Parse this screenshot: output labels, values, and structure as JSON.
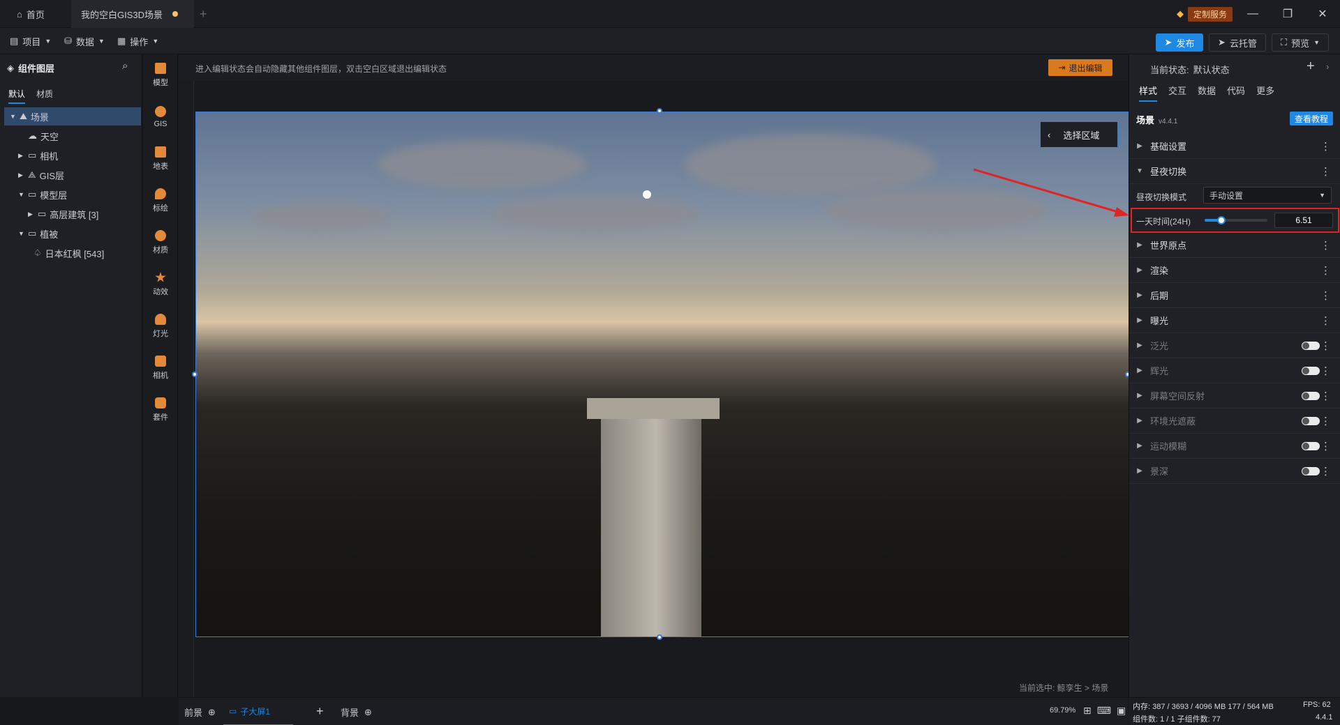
{
  "titlebar": {
    "home_tab": "首页",
    "active_tab": "我的空白GIS3D场景",
    "new_tab": "+",
    "custom_service": "定制服务"
  },
  "menubar": {
    "project": "项目",
    "data": "数据",
    "operate": "操作",
    "publish": "发布",
    "cloud": "云托管",
    "preview": "预览"
  },
  "left_panel": {
    "title": "组件图层",
    "tabs": [
      "默认",
      "材质"
    ],
    "tree": [
      {
        "label": "场景"
      },
      {
        "label": "天空"
      },
      {
        "label": "相机"
      },
      {
        "label": "GIS层"
      },
      {
        "label": "模型层"
      },
      {
        "label": "高层建筑 [3]"
      },
      {
        "label": "植被"
      },
      {
        "label": "日本红枫 [543]"
      }
    ]
  },
  "tools": [
    {
      "label": "模型"
    },
    {
      "label": "GIS"
    },
    {
      "label": "地表"
    },
    {
      "label": "标绘"
    },
    {
      "label": "材质"
    },
    {
      "label": "动效"
    },
    {
      "label": "灯光"
    },
    {
      "label": "相机"
    },
    {
      "label": "套件"
    }
  ],
  "canvas": {
    "info": "进入编辑状态会自动隐藏其他组件图层，双击空白区域退出编辑状态",
    "exit_edit": "退出编辑",
    "select_area": "选择区域",
    "current_selected": "当前选中: 鲸孪生 > 场景"
  },
  "bottombar": {
    "foreground": "前景",
    "sub_screen": "子大屏1",
    "background": "背景",
    "zoom": "69.79%"
  },
  "right_panel": {
    "state_label": "当前状态:",
    "state_value": "默认状态",
    "tabs": [
      "样式",
      "交互",
      "数据",
      "代码",
      "更多"
    ],
    "component_name": "场景",
    "version": "v4.4.1",
    "tutorial": "查看教程",
    "sections": [
      {
        "label": "基础设置"
      },
      {
        "label": "昼夜切换"
      }
    ],
    "daynight_mode_label": "昼夜切换模式",
    "daynight_mode_value": "手动设置",
    "time_label": "一天时间(24H)",
    "time_value": "6.51",
    "time_slider_fraction": 0.27,
    "sections_after": [
      {
        "label": "世界原点"
      },
      {
        "label": "渲染"
      },
      {
        "label": "后期"
      },
      {
        "label": "曝光"
      }
    ],
    "toggle_sections": [
      {
        "label": "泛光"
      },
      {
        "label": "辉光"
      },
      {
        "label": "屏幕空间反射"
      },
      {
        "label": "环境光遮蔽"
      },
      {
        "label": "运动模糊"
      },
      {
        "label": "景深"
      }
    ]
  },
  "statusbar": {
    "memory": "内存: 387 / 3693 / 4096 MB  177 / 564 MB",
    "fps": "FPS: 62",
    "components": "组件数: 1 / 1   子组件数: 77",
    "version": "4.4.1"
  },
  "colors": {
    "accent": "#1e88e5",
    "highlight_box": "#e02424",
    "exit_button": "#d97a1f",
    "selected_tree": "#2f4a6b"
  }
}
